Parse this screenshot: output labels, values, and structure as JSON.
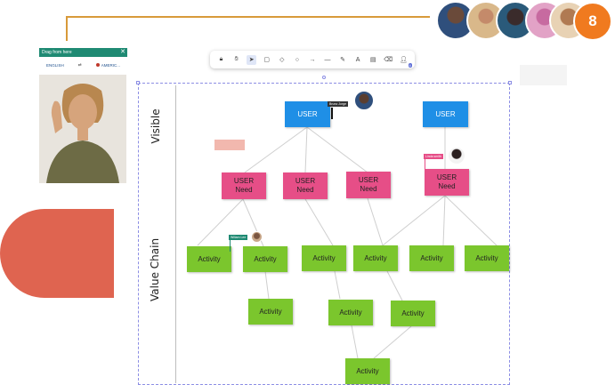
{
  "participants": {
    "count": "8",
    "avatars": [
      "participant-1",
      "participant-2",
      "participant-3",
      "participant-4",
      "participant-5"
    ]
  },
  "translate_widget": {
    "title": "Drag from here",
    "source_language": "ENGLISH",
    "swap": "⇄",
    "target_language": "AMERIC..."
  },
  "toolbar": {
    "tools": [
      "lock-icon",
      "hand-icon",
      "pointer-icon",
      "rectangle-icon",
      "diamond-icon",
      "circle-icon",
      "arrow-icon",
      "line-icon",
      "pen-icon",
      "text-icon",
      "frame-icon",
      "eraser-icon",
      "users-icon"
    ],
    "users_badge": "4"
  },
  "board": {
    "lanes": {
      "visible": "Visible",
      "value_chain": "Value Chain"
    },
    "cursors": [
      {
        "label": "Bruno Jorge",
        "color": "#333333"
      },
      {
        "label": "Linda smith",
        "color": "#e64e87"
      },
      {
        "label": "Wiliam Lee",
        "color": "#1f8a73"
      }
    ],
    "notes": {
      "user_1": "USER",
      "user_2": "USER",
      "need_1": "USER Need",
      "need_2": "USER Need",
      "need_3": "USER Need",
      "need_4": "USER Need",
      "activity": "Activity"
    }
  },
  "colors": {
    "user": "#1f8fe6",
    "need": "#e64e87",
    "activity": "#7bc62d",
    "accent": "#f07a1f",
    "frame": "#8c8ee4"
  }
}
